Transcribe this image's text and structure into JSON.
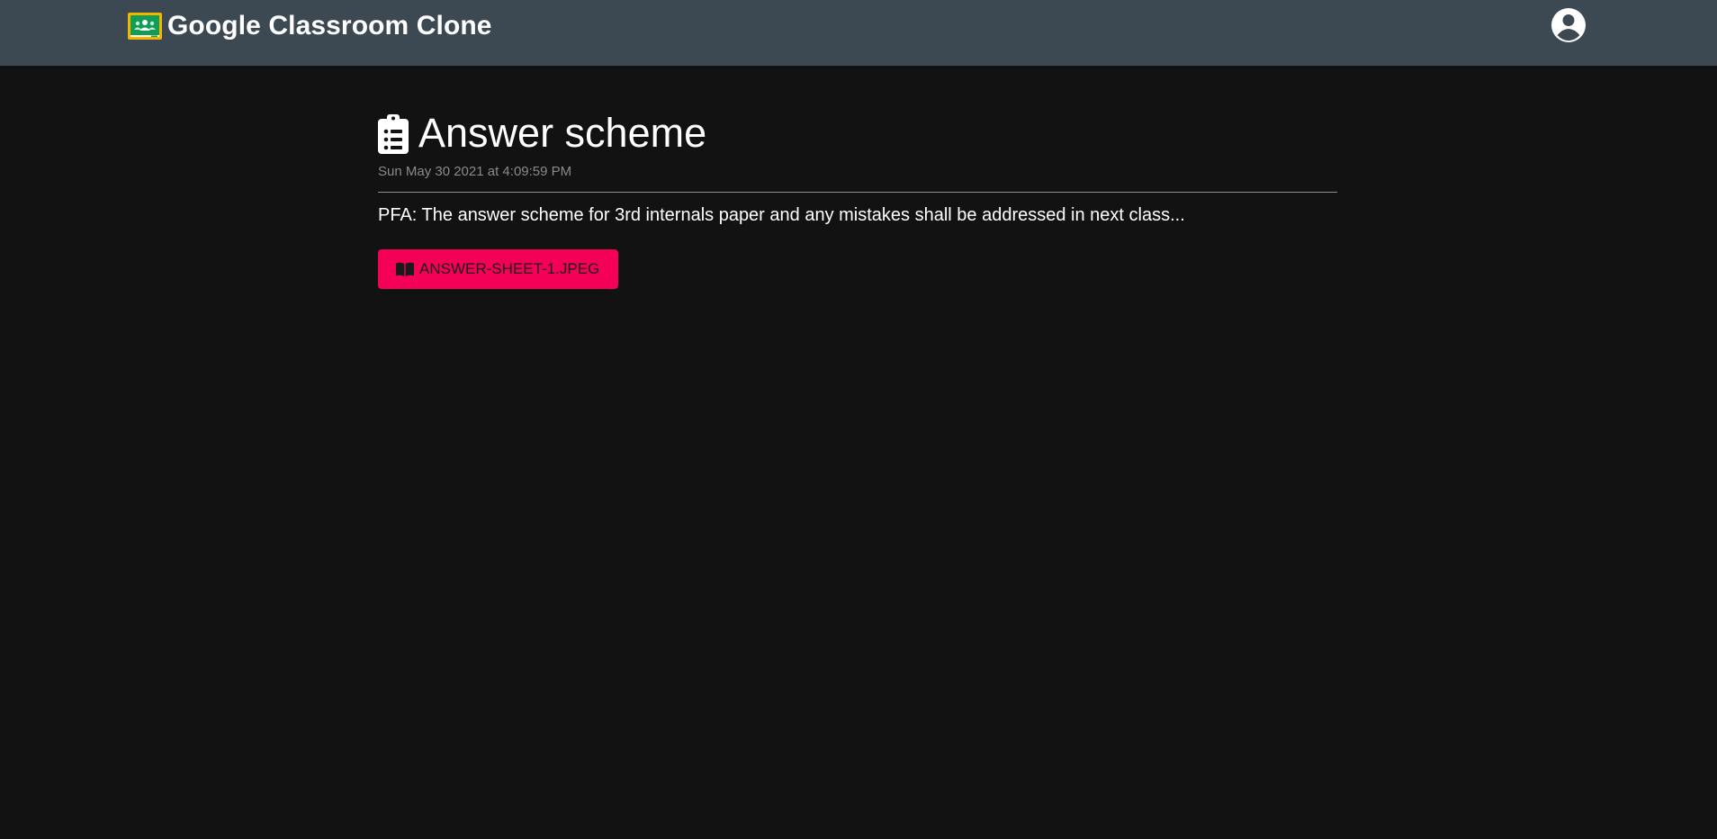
{
  "navbar": {
    "brand_title": "Google Classroom Clone",
    "logo_icon": "google-classroom-logo-icon",
    "account_icon": "account-circle-icon",
    "background_color": "#3c4852"
  },
  "post": {
    "title_icon": "clipboard-list-icon",
    "title": "Answer scheme",
    "timestamp": "Sun May 30 2021 at 4:09:59 PM",
    "description": "PFA: The answer scheme for 3rd internals paper and any mistakes shall be addressed in next class...",
    "attachment": {
      "icon": "book-open-icon",
      "label": "ANSWER-SHEET-1.JPEG",
      "color": "#f50057"
    }
  },
  "page": {
    "background_color": "#121212"
  }
}
